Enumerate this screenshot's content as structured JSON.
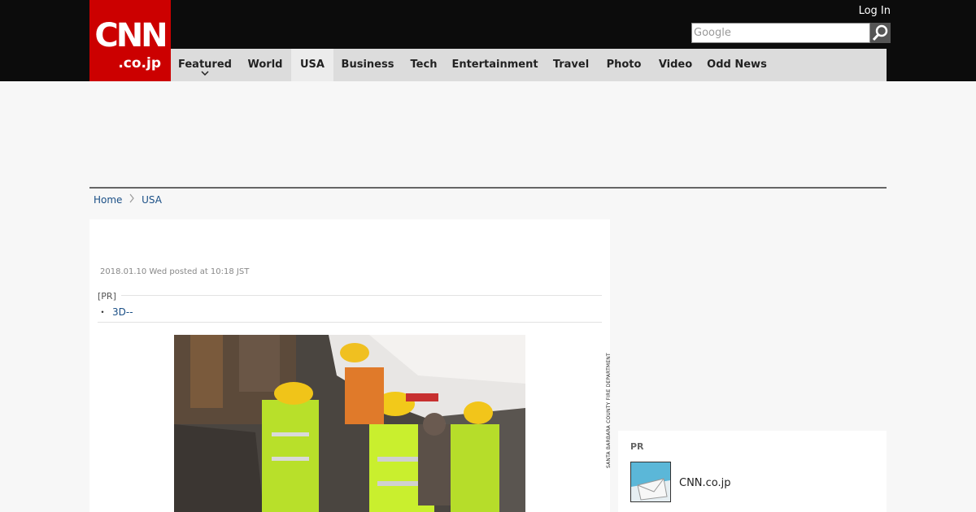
{
  "brand": {
    "logo_main": "CNN",
    "logo_sub": ".co.jp"
  },
  "header": {
    "login_label": "Log In",
    "search_placeholder": "Google",
    "search_icon": "magnifier-icon"
  },
  "nav": {
    "items": [
      {
        "label": "Featured",
        "has_dropdown": true
      },
      {
        "label": "World"
      },
      {
        "label": "USA",
        "active": true
      },
      {
        "label": "Business"
      },
      {
        "label": "Tech"
      },
      {
        "label": "Entertainment"
      },
      {
        "label": "Travel"
      },
      {
        "label": "Photo"
      },
      {
        "label": "Video"
      },
      {
        "label": "Odd News"
      }
    ]
  },
  "breadcrumb": {
    "home": "Home",
    "current": "USA"
  },
  "article": {
    "posted": "2018.01.10 Wed posted at 10:18 JST",
    "pr_label": "[PR]",
    "pr_link": "3D--",
    "photo_credit": "SANTA BARBARA COUNTY FIRE DEPARTMENT"
  },
  "sidebar": {
    "pr_title": "PR",
    "pr_item": "CNN.co.jp"
  },
  "colors": {
    "brand_red": "#cc0000",
    "link_blue": "#1a4f86",
    "header_bg": "#0c0c0c",
    "nav_bg": "#dcdcdc"
  }
}
